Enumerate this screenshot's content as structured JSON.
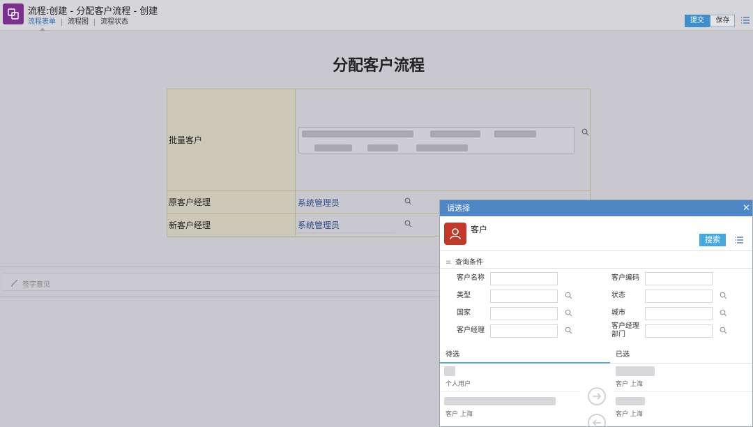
{
  "header": {
    "title": "流程:创建 - 分配客户流程 - 创建",
    "tabs": [
      "流程表单",
      "流程图",
      "流程状态"
    ],
    "submit_label": "提交",
    "save_label": "保存"
  },
  "form": {
    "title": "分配客户流程",
    "rows": [
      {
        "label": "批量客户",
        "value": ""
      },
      {
        "label": "原客户经理",
        "value": "系统管理员"
      },
      {
        "label": "新客户经理",
        "value": "系统管理员"
      }
    ]
  },
  "signature": {
    "placeholder": "签字意见"
  },
  "dialog": {
    "title": "请选择",
    "close_glyph": "✕",
    "entity_name": "客户",
    "search_label": "搜索",
    "query_title": "查询条件",
    "query_fields": {
      "name": "客户名称",
      "code": "客户编码",
      "type": "类型",
      "status": "状态",
      "country": "国家",
      "city": "城市",
      "manager": "客户经理",
      "manager_dept": "客户经理部门"
    },
    "pending_label": "待选",
    "selected_label": "已选",
    "pending_items": [
      {
        "sub": "个人用户"
      },
      {
        "sub": "客户  上海"
      }
    ],
    "selected_items": [
      {
        "sub": "客户  上海"
      },
      {
        "sub": "客户  上海"
      }
    ]
  },
  "colors": {
    "accent_blue": "#3f8dcb",
    "dialog_header": "#4f86c6",
    "app_icon": "#7b2f8f",
    "entity_icon": "#c0392b",
    "search_button": "#45a9e0"
  },
  "icons": [
    "app-logo-icon",
    "menu-icon",
    "search-icon",
    "pen-icon",
    "user-icon",
    "arrow-right-icon",
    "arrow-left-icon",
    "close-icon"
  ]
}
